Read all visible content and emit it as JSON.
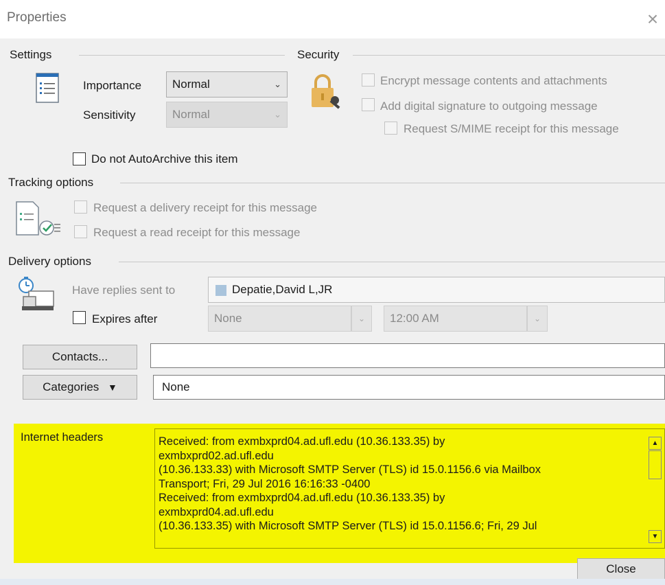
{
  "window": {
    "title": "Properties",
    "close_glyph": "×"
  },
  "settings": {
    "heading": "Settings",
    "importance_label": "Importance",
    "importance_value": "Normal",
    "sensitivity_label": "Sensitivity",
    "sensitivity_value": "Normal",
    "autoarchive_label": "Do not AutoArchive this item"
  },
  "security": {
    "heading": "Security",
    "encrypt_label": "Encrypt message contents and attachments",
    "signature_label": "Add digital signature to outgoing message",
    "smime_label": "Request S/MIME receipt for this message"
  },
  "tracking": {
    "heading": "Tracking options",
    "delivery_receipt_label": "Request a delivery receipt for this message",
    "read_receipt_label": "Request a read receipt for this message"
  },
  "delivery": {
    "heading": "Delivery options",
    "replies_label": "Have replies sent to",
    "replies_value": "Depatie,David L,JR",
    "expires_label": "Expires after",
    "expires_date": "None",
    "expires_time": "12:00 AM"
  },
  "contacts": {
    "button_label": "Contacts...",
    "value": ""
  },
  "categories": {
    "button_label": "Categories",
    "button_arrow": "▼",
    "value": "None"
  },
  "internet_headers": {
    "label": "Internet headers",
    "lines": [
      "Received: from exmbxprd04.ad.ufl.edu (10.36.133.35) by",
      "exmbxprd02.ad.ufl.edu",
      " (10.36.133.33) with Microsoft SMTP Server (TLS) id 15.0.1156.6 via Mailbox",
      " Transport; Fri, 29 Jul 2016 16:16:33 -0400",
      "Received: from exmbxprd04.ad.ufl.edu (10.36.133.35) by",
      "exmbxprd04.ad.ufl.edu",
      " (10.36.133.35) with Microsoft SMTP Server (TLS) id 15.0.1156.6; Fri, 29 Jul"
    ]
  },
  "footer": {
    "close_label": "Close"
  },
  "colors": {
    "headers_highlight": "#f4f400",
    "dialog_bg": "#f0f0f0"
  },
  "icons": [
    "settings-list-icon",
    "security-lock-key-icon",
    "tracking-checklist-icon",
    "delivery-timer-icon",
    "contact-card-icon",
    "dropdown-chevron-icon",
    "scroll-up-icon",
    "scroll-down-icon"
  ]
}
